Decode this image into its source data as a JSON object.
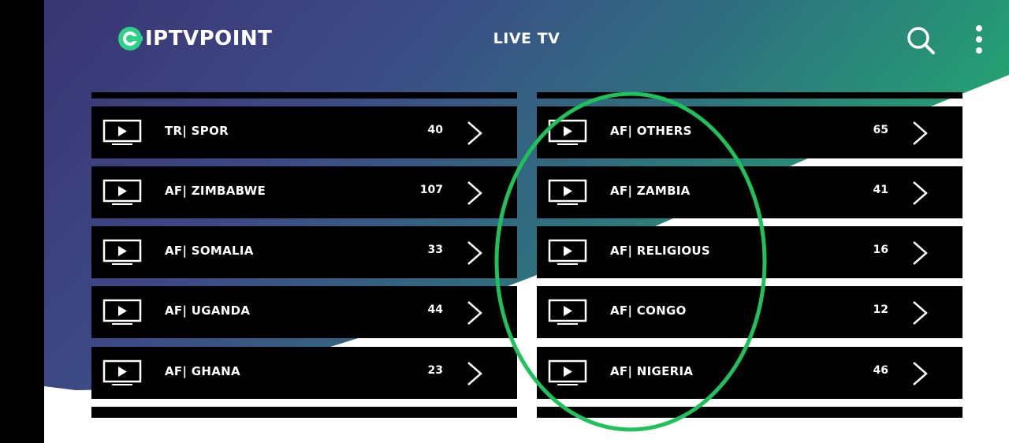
{
  "app": {
    "logo_text": "IPTVPOINT",
    "title": "LIVE TV"
  },
  "icons": {
    "search": "search-icon",
    "more": "more-vertical-icon",
    "tv": "tv-play-icon",
    "chevron": "chevron-right-icon"
  },
  "colors": {
    "accent_green": "#21b36a",
    "highlight_ellipse": "#1fc15b",
    "row_bg": "#000000",
    "text": "#ffffff"
  },
  "categories_left": [
    {
      "name": "TR|  SPOR",
      "count": "40"
    },
    {
      "name": "AF| ZIMBABWE",
      "count": "107"
    },
    {
      "name": "AF| SOMALIA",
      "count": "33"
    },
    {
      "name": "AF| UGANDA",
      "count": "44"
    },
    {
      "name": "AF| GHANA",
      "count": "23"
    }
  ],
  "categories_right": [
    {
      "name": "AF| OTHERS",
      "count": "65"
    },
    {
      "name": "AF| ZAMBIA",
      "count": "41"
    },
    {
      "name": "AF| RELIGIOUS",
      "count": "16"
    },
    {
      "name": "AF| CONGO",
      "count": "12"
    },
    {
      "name": "AF| NIGERIA",
      "count": "46"
    }
  ]
}
